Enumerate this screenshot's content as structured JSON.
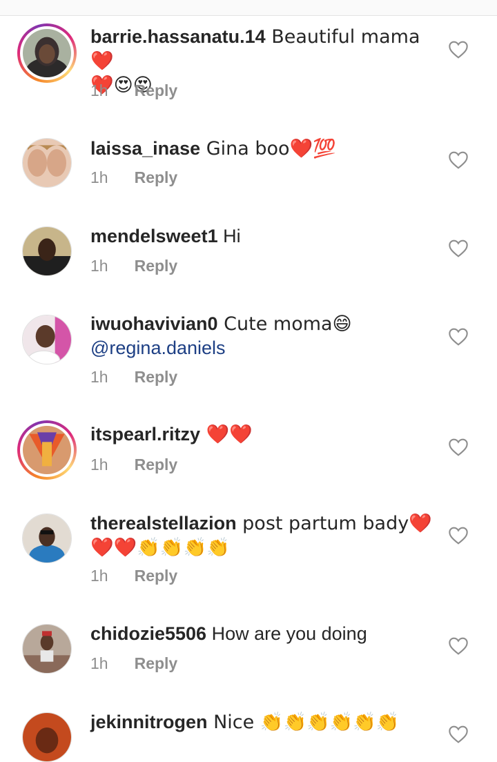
{
  "comments": [
    {
      "username": "barrie.hassanatu.14",
      "text": " Beautiful mama ❤️",
      "line2": "❤️😍😍",
      "time": "1h",
      "reply_label": "Reply"
    },
    {
      "username": "laissa_inase",
      "text": " Gina boo❤️💯",
      "time": "1h",
      "reply_label": "Reply"
    },
    {
      "username": "mendelsweet1",
      "text": " Hi",
      "time": "1h",
      "reply_label": "Reply"
    },
    {
      "username": "iwuohavivian0",
      "text": " Cute moma😄",
      "mention": "@regina.daniels",
      "time": "1h",
      "reply_label": "Reply"
    },
    {
      "username": "itspearl.ritzy",
      "text": " ❤️❤️",
      "time": "1h",
      "reply_label": "Reply"
    },
    {
      "username": "therealstellazion",
      "text": " post partum bady❤️",
      "line2": "❤️❤️👏👏👏👏",
      "time": "1h",
      "reply_label": "Reply"
    },
    {
      "username": "chidozie5506",
      "text": " How are you doing",
      "time": "1h",
      "reply_label": "Reply"
    },
    {
      "username": "jekinnitrogen",
      "text": " Nice 👏👏👏👏👏👏"
    }
  ],
  "icons": {
    "like": "heart-outline-icon"
  },
  "colors": {
    "mention": "#1d3f84",
    "meta": "#8e8e8e",
    "story_ring_start": "#f58529",
    "story_ring_end": "#dd2a7b"
  }
}
